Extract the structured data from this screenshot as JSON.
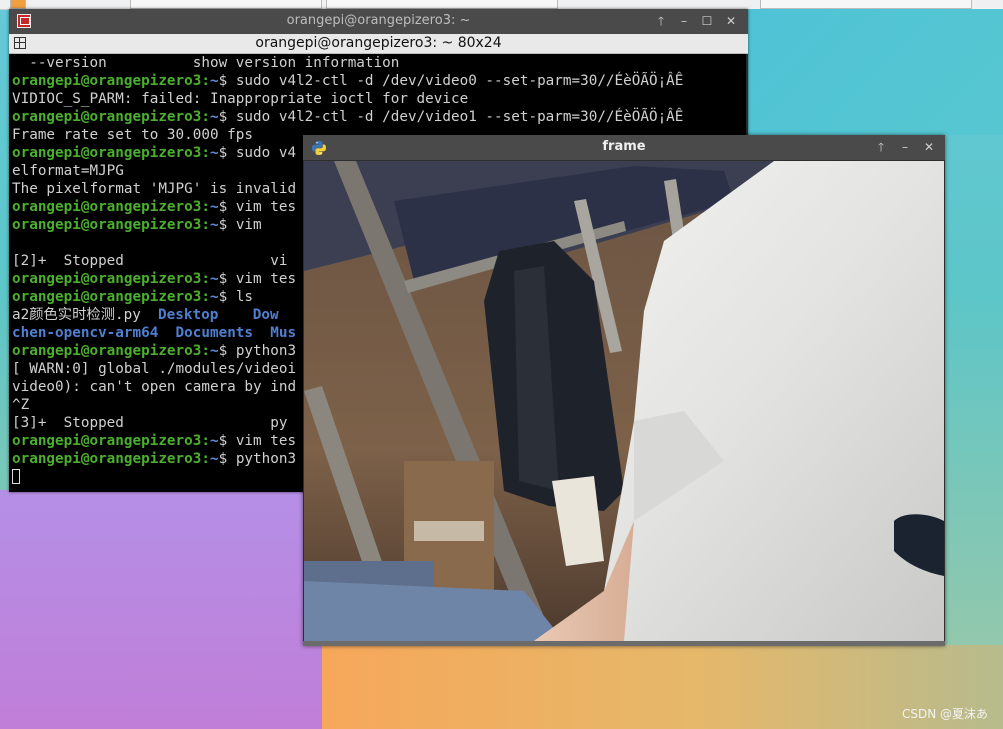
{
  "terminal": {
    "window_title": "orangepi@orangepizero3: ~",
    "subtitle": "orangepi@orangepizero3: ~ 80x24",
    "buttons": {
      "up": "🡑",
      "minimize": "–",
      "maximize": "☐",
      "close": "✕"
    },
    "lines": [
      {
        "text": "  --version          show version information"
      },
      {
        "prompt_user": "orangepi@orangepizero3",
        "prompt_sep": ":",
        "prompt_dir": "~",
        "prompt_end": "$ ",
        "cmd": "sudo v4l2-ctl -d /dev/video0 --set-parm=30//ÉèÖÃÖ¡ÂÊ"
      },
      {
        "text": "VIDIOC_S_PARM: failed: Inappropriate ioctl for device"
      },
      {
        "prompt_user": "orangepi@orangepizero3",
        "prompt_sep": ":",
        "prompt_dir": "~",
        "prompt_end": "$ ",
        "cmd": "sudo v4l2-ctl -d /dev/video1 --set-parm=30//ÉèÖÃÖ¡ÂÊ"
      },
      {
        "text": "Frame rate set to 30.000 fps"
      },
      {
        "prompt_user": "orangepi@orangepizero3",
        "prompt_sep": ":",
        "prompt_dir": "~",
        "prompt_end": "$ ",
        "cmd": "sudo v4"
      },
      {
        "text": "elformat=MJPG"
      },
      {
        "text": "The pixelformat 'MJPG' is invalid"
      },
      {
        "prompt_user": "orangepi@orangepizero3",
        "prompt_sep": ":",
        "prompt_dir": "~",
        "prompt_end": "$ ",
        "cmd": "vim tes"
      },
      {
        "prompt_user": "orangepi@orangepizero3",
        "prompt_sep": ":",
        "prompt_dir": "~",
        "prompt_end": "$ ",
        "cmd": "vim"
      },
      {
        "text": ""
      },
      {
        "text": "[2]+  Stopped                 vi"
      },
      {
        "prompt_user": "orangepi@orangepizero3",
        "prompt_sep": ":",
        "prompt_dir": "~",
        "prompt_end": "$ ",
        "cmd": "vim tes"
      },
      {
        "prompt_user": "orangepi@orangepizero3",
        "prompt_sep": ":",
        "prompt_dir": "~",
        "prompt_end": "$ ",
        "cmd": "ls"
      },
      {
        "ls": [
          "a2颜色实时检测.py  ",
          "Desktop",
          "    ",
          "Dow"
        ]
      },
      {
        "ls": [
          "",
          "chen-opencv-arm64",
          "  ",
          "Documents",
          "  ",
          "Mus"
        ]
      },
      {
        "prompt_user": "orangepi@orangepizero3",
        "prompt_sep": ":",
        "prompt_dir": "~",
        "prompt_end": "$ ",
        "cmd": "python3"
      },
      {
        "text": "[ WARN:0] global ./modules/videoi"
      },
      {
        "text": "video0): can't open camera by ind"
      },
      {
        "text": "^Z"
      },
      {
        "text": "[3]+  Stopped                 py"
      },
      {
        "prompt_user": "orangepi@orangepizero3",
        "prompt_sep": ":",
        "prompt_dir": "~",
        "prompt_end": "$ ",
        "cmd": "vim tes"
      },
      {
        "prompt_user": "orangepi@orangepizero3",
        "prompt_sep": ":",
        "prompt_dir": "~",
        "prompt_end": "$ ",
        "cmd": "python3"
      }
    ]
  },
  "frame_window": {
    "title": "frame",
    "buttons": {
      "up": "🡑",
      "minimize": "–",
      "close": "✕"
    }
  },
  "watermark": "CSDN @夏沫あ"
}
